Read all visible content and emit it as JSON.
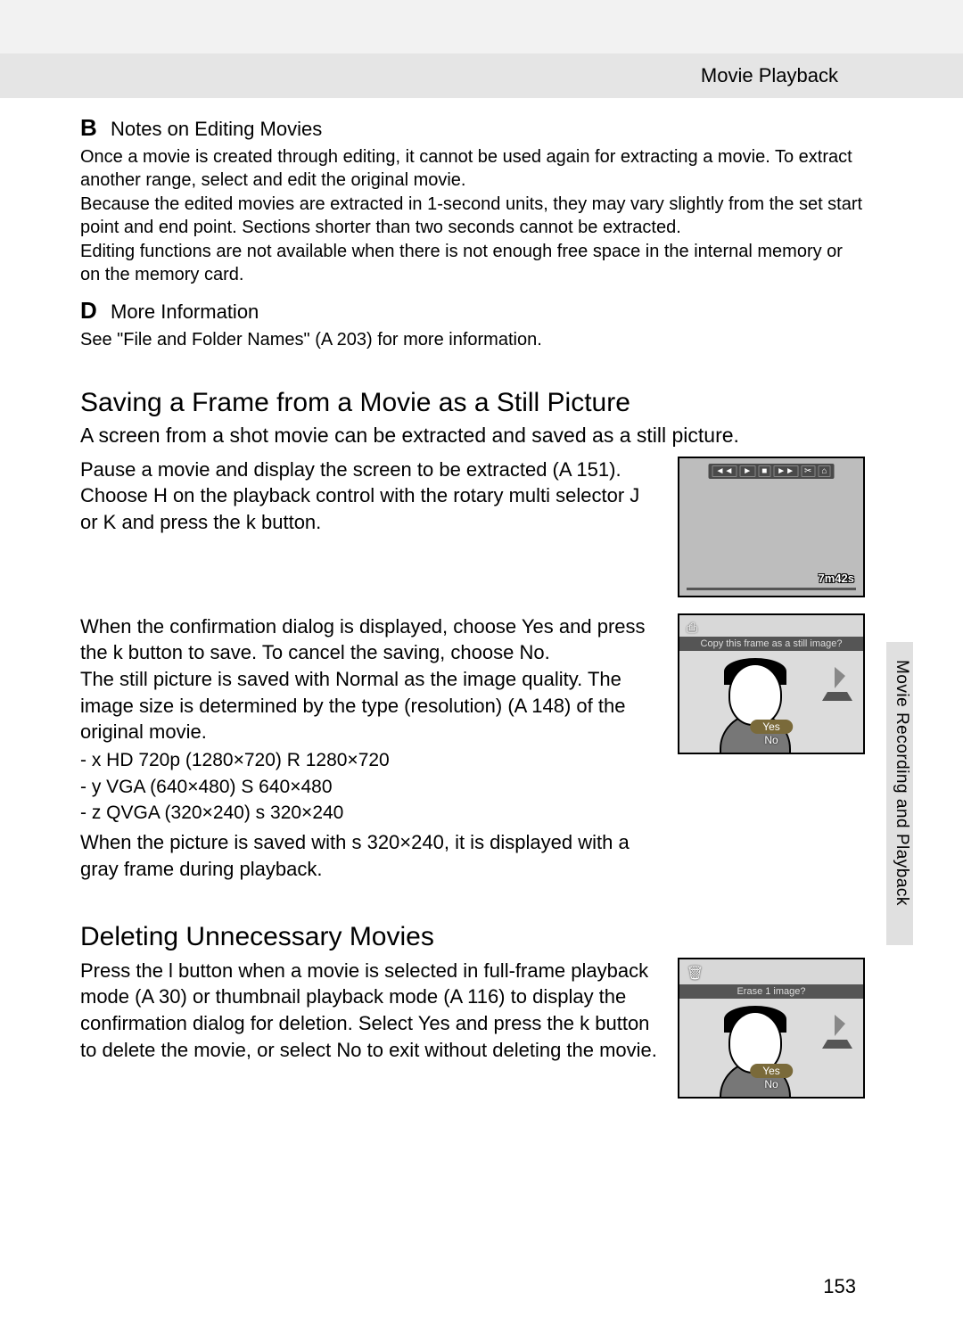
{
  "header": {
    "title": "Movie Playback"
  },
  "notes": {
    "icon1": "B",
    "heading1": "Notes on Editing Movies",
    "body1": "Once a movie is created through editing, it cannot be used again for extracting a movie. To extract another range, select and edit the original movie.\nBecause the edited movies are extracted in 1-second units, they may vary slightly from the set start point and end point. Sections shorter than two seconds cannot be extracted.\nEditing functions are not available when there is not enough free space in the internal memory or on the memory card.",
    "icon2": "D",
    "heading2": "More Information",
    "body2": "See \"File and Folder Names\" (A 203) for more information."
  },
  "saving": {
    "heading": "Saving a Frame from a Movie as a Still Picture",
    "lead": "A screen from a shot movie can be extracted and saved as a still picture.",
    "p1": "Pause a movie and display the screen to be extracted (A 151).\nChoose H on the playback control with the rotary multi selector J or K and press the k button.",
    "p2": "When the confirmation dialog is displayed, choose Yes and press the k button to save. To cancel the saving, choose No.\nThe still picture is saved with Normal as the image quality. The image size is determined by the type (resolution) (A 148) of the original movie.",
    "bullets": "- x   HD 720p (1280×720)  R  1280×720\n- y   VGA (640×480)  S  640×480\n- z   QVGA (320×240)  s  320×240",
    "p3": "When the picture is saved with s 320×240, it is displayed with a gray frame during playback.",
    "lcd": {
      "time": "7m42s",
      "controls": [
        "◄◄",
        "►",
        "■",
        "►►",
        "✂",
        "⌂"
      ],
      "prompt": "Copy this frame as a still image?",
      "yes": "Yes",
      "no": "No"
    }
  },
  "deleting": {
    "heading": "Deleting Unnecessary Movies",
    "p1": "Press the l button when a movie is selected in full-frame playback mode (A 30) or thumbnail playback mode (A 116) to display the confirmation dialog for deletion. Select Yes and press the k button to delete the movie, or select No to exit without deleting the movie.",
    "prompt": "Erase 1 image?",
    "yes": "Yes",
    "no": "No"
  },
  "side": {
    "label": "Movie Recording and Playback"
  },
  "page": "153"
}
